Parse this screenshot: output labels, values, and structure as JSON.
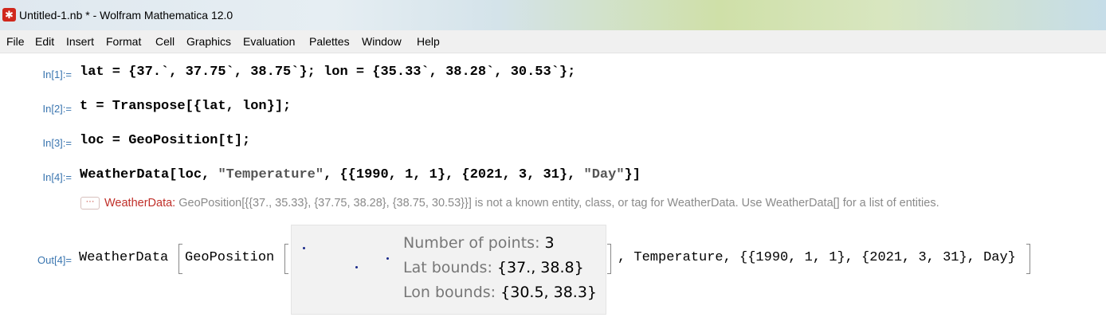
{
  "window": {
    "title": "Untitled-1.nb * - Wolfram Mathematica 12.0",
    "icon": "mathematica-icon"
  },
  "menu": [
    "File",
    "Edit",
    "Insert",
    "Format",
    "Cell",
    "Graphics",
    "Evaluation",
    "Palettes",
    "Window",
    "Help"
  ],
  "cells": {
    "in1": {
      "label": "In[1]:=",
      "code": "lat = {37.`, 37.75`, 38.75`}; lon = {35.33`, 38.28`, 30.53`};"
    },
    "in2": {
      "label": "In[2]:=",
      "code": "t = Transpose[{lat, lon}];"
    },
    "in3": {
      "label": "In[3]:=",
      "code": "loc = GeoPosition[t];"
    },
    "in4": {
      "label": "In[4]:=",
      "code_pre": "WeatherData[loc, ",
      "code_str1": "\"Temperature\"",
      "code_mid": ", {{1990, 1, 1}, {2021, 3, 31}, ",
      "code_str2": "\"Day\"",
      "code_post": "}]"
    },
    "message": {
      "button": "···",
      "name": "WeatherData:",
      "text": " GeoPosition[{{37., 35.33}, {37.75, 38.28}, {38.75, 30.53}}] is not a known entity, class, or tag for WeatherData. Use WeatherData[] for a list of entities."
    },
    "out4": {
      "label": "Out[4]=",
      "head": "WeatherData",
      "geo": "GeoPosition",
      "rest": ", Temperature, {{1990, 1, 1}, {2021, 3, 31}, Day}",
      "summary": {
        "points_label": "Number of points: ",
        "points": "3",
        "lat_label": "Lat bounds: ",
        "lat": "{37., 38.8}",
        "lon_label": "Lon bounds: ",
        "lon": "{30.5, 38.3}"
      }
    }
  },
  "colors": {
    "label": "#3b76b0",
    "error": "#c0302a",
    "message": "#8a8a8a"
  }
}
